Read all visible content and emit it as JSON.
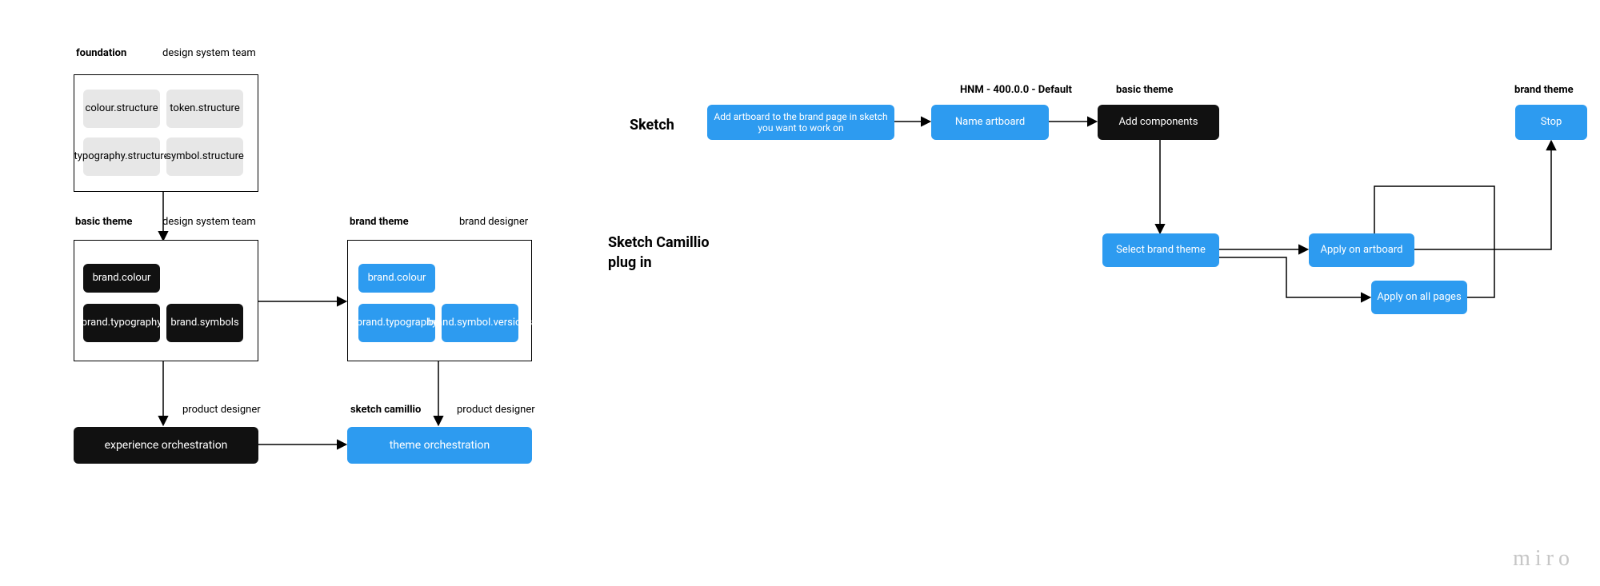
{
  "left": {
    "foundation": {
      "title": "foundation",
      "team": "design system team",
      "items": {
        "colour": "colour.structure",
        "token": "token.structure",
        "typography": "typography.structure",
        "symbol": "symbol.structure"
      }
    },
    "basic_theme": {
      "title": "basic theme",
      "team": "design system team",
      "items": {
        "colour": "brand.colour",
        "typography": "brand.typography",
        "symbols": "brand.symbols"
      }
    },
    "brand_theme": {
      "title": "brand theme",
      "team": "brand designer",
      "items": {
        "colour": "brand.colour",
        "typography": "brand.typography",
        "symbol_versions": "brand.symbol.versions"
      }
    },
    "experience_orch": "experience orchestration",
    "theme_orch": "theme orchestration",
    "product_designer_left": "product designer",
    "product_designer_right": "product designer",
    "sketch_camillio_label": "sketch camillio"
  },
  "right": {
    "sketch_label": "Sketch",
    "plugin_label_l1": "Sketch Camillio",
    "plugin_label_l2": "plug in",
    "hnm_default": "HNM - 400.0.0 - Default",
    "basic_theme_header": "basic theme",
    "brand_theme_header": "brand theme",
    "add_artboard": "Add artboard to the brand page in sketch you want to work on",
    "name_artboard": "Name artboard",
    "add_components": "Add components",
    "select_brand_theme": "Select brand theme",
    "apply_on_artboard": "Apply on artboard",
    "apply_on_all_pages": "Apply on all pages",
    "stop": "Stop"
  },
  "watermark": "miro"
}
